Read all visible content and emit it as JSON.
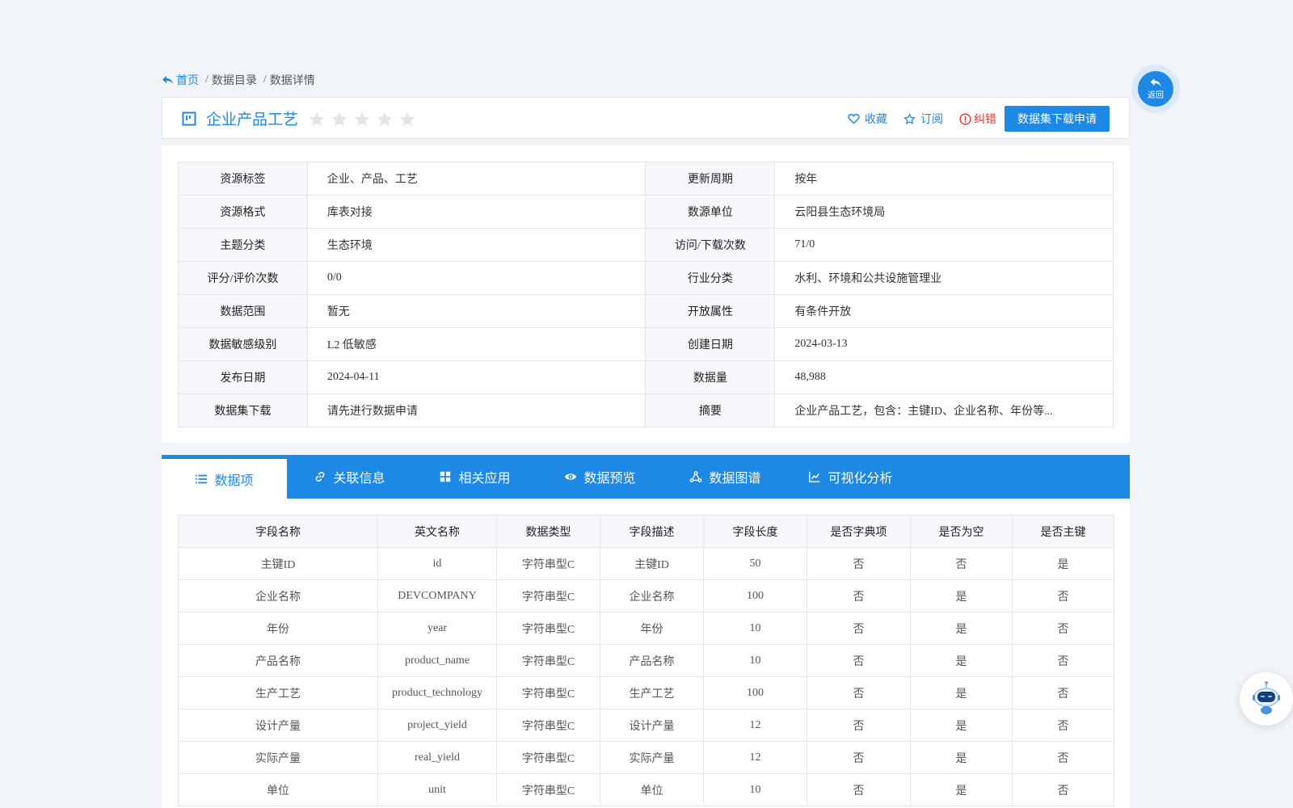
{
  "breadcrumb": {
    "home": "首页",
    "items": [
      "数据目录",
      "数据详情"
    ],
    "separator": "/"
  },
  "header": {
    "title": "企业产品工艺",
    "rating": 0,
    "rating_max": 5,
    "actions": {
      "favorite": "收藏",
      "subscribe": "订阅",
      "report": "纠错",
      "apply": "数据集下载申请"
    }
  },
  "info": {
    "rows": [
      [
        {
          "label": "资源标签",
          "value": "企业、产品、工艺"
        },
        {
          "label": "更新周期",
          "value": "按年"
        }
      ],
      [
        {
          "label": "资源格式",
          "value": "库表对接"
        },
        {
          "label": "数源单位",
          "value": "云阳县生态环境局"
        }
      ],
      [
        {
          "label": "主题分类",
          "value": "生态环境"
        },
        {
          "label": "访问/下载次数",
          "value": "71/0"
        }
      ],
      [
        {
          "label": "评分/评价次数",
          "value": "0/0"
        },
        {
          "label": "行业分类",
          "value": "水利、环境和公共设施管理业"
        }
      ],
      [
        {
          "label": "数据范围",
          "value": "暂无"
        },
        {
          "label": "开放属性",
          "value": "有条件开放"
        }
      ],
      [
        {
          "label": "数据敏感级别",
          "value": "L2 低敏感"
        },
        {
          "label": "创建日期",
          "value": "2024-03-13"
        }
      ],
      [
        {
          "label": "发布日期",
          "value": "2024-04-11"
        },
        {
          "label": "数据量",
          "value": "48,988"
        }
      ],
      [
        {
          "label": "数据集下载",
          "value": "请先进行数据申请"
        },
        {
          "label": "摘要",
          "value": "企业产品工艺，包含：主键ID、企业名称、年份等..."
        }
      ]
    ]
  },
  "tabs": [
    {
      "label": "数据项",
      "icon": "list-icon",
      "active": true
    },
    {
      "label": "关联信息",
      "icon": "link-icon",
      "active": false
    },
    {
      "label": "相关应用",
      "icon": "grid-icon",
      "active": false
    },
    {
      "label": "数据预览",
      "icon": "eye-icon",
      "active": false
    },
    {
      "label": "数据图谱",
      "icon": "graph-icon",
      "active": false
    },
    {
      "label": "可视化分析",
      "icon": "line-chart-icon",
      "active": false
    }
  ],
  "fields": {
    "headers": [
      "字段名称",
      "英文名称",
      "数据类型",
      "字段描述",
      "字段长度",
      "是否字典项",
      "是否为空",
      "是否主键"
    ],
    "rows": [
      [
        "主键ID",
        "id",
        "字符串型C",
        "主键ID",
        "50",
        "否",
        "否",
        "是"
      ],
      [
        "企业名称",
        "DEVCOMPANY",
        "字符串型C",
        "企业名称",
        "100",
        "否",
        "是",
        "否"
      ],
      [
        "年份",
        "year",
        "字符串型C",
        "年份",
        "10",
        "否",
        "是",
        "否"
      ],
      [
        "产品名称",
        "product_name",
        "字符串型C",
        "产品名称",
        "10",
        "否",
        "是",
        "否"
      ],
      [
        "生产工艺",
        "product_technology",
        "字符串型C",
        "生产工艺",
        "100",
        "否",
        "是",
        "否"
      ],
      [
        "设计产量",
        "project_yield",
        "字符串型C",
        "设计产量",
        "12",
        "否",
        "是",
        "否"
      ],
      [
        "实际产量",
        "real_yield",
        "字符串型C",
        "实际产量",
        "12",
        "否",
        "是",
        "否"
      ],
      [
        "单位",
        "unit",
        "字符串型C",
        "单位",
        "10",
        "否",
        "是",
        "否"
      ]
    ]
  },
  "float": {
    "back_label": "返回"
  },
  "colors": {
    "accent": "#1e88e5",
    "error": "#e53935",
    "label_bg": "#f5f7fa",
    "page_bg": "#f1f5f9"
  }
}
